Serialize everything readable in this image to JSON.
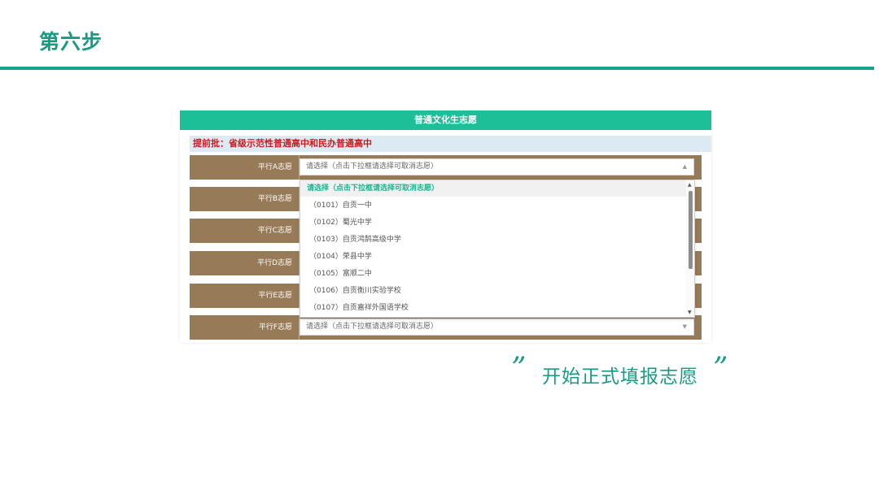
{
  "slide": {
    "title": "第六步",
    "quote_open": "”",
    "quote_close": "”",
    "caption": "开始正式填报志愿"
  },
  "form": {
    "header": "普通文化生志愿",
    "batch_label": "提前批：省级示范性普通高中和民办普通高中",
    "rows": [
      {
        "label": "平行A志愿",
        "value": "请选择（点击下拉框请选择可取消志愿）",
        "arrow": "▲"
      },
      {
        "label": "平行B志愿",
        "value": "",
        "arrow": ""
      },
      {
        "label": "平行C志愿",
        "value": "",
        "arrow": ""
      },
      {
        "label": "平行D志愿",
        "value": "",
        "arrow": ""
      },
      {
        "label": "平行E志愿",
        "value": "",
        "arrow": ""
      },
      {
        "label": "平行F志愿",
        "value": "请选择（点击下拉框请选择可取消志愿）",
        "arrow": "▼"
      }
    ]
  },
  "dropdown": {
    "options": [
      "请选择（点击下拉框请选择可取消志愿）",
      "（0101）自贡一中",
      "（0102）蜀光中学",
      "（0103）自贡鸿鹄高级中学",
      "（0104）荣县中学",
      "（0105）富顺二中",
      "（0106）自贡衡川实验学校",
      "（0107）自贡嘉祥外国语学校"
    ],
    "scroll_up": "▲",
    "scroll_down": "▼"
  }
}
